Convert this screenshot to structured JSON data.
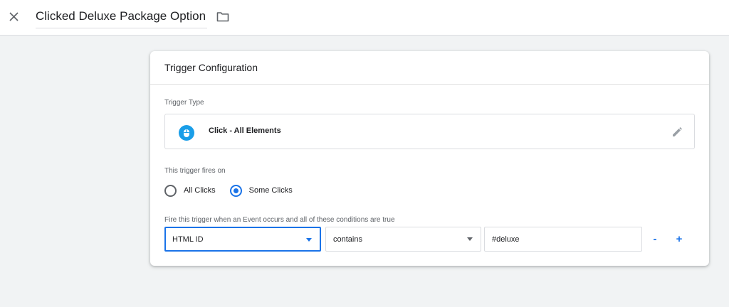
{
  "header": {
    "title": "Clicked Deluxe Package Option",
    "close_icon": "close-icon",
    "folder_icon": "folder-icon"
  },
  "card": {
    "title": "Trigger Configuration",
    "trigger_type": {
      "label": "Trigger Type",
      "icon": "mouse-icon",
      "name": "Click - All Elements",
      "edit_icon": "pencil-icon"
    },
    "fires_on": {
      "label": "This trigger fires on",
      "options": [
        {
          "label": "All Clicks",
          "selected": false
        },
        {
          "label": "Some Clicks",
          "selected": true
        }
      ]
    },
    "conditions": {
      "label": "Fire this trigger when an Event occurs and all of these conditions are true",
      "variable": "HTML ID",
      "operator": "contains",
      "value": "#deluxe",
      "remove_label": "-",
      "add_label": "+"
    }
  },
  "colors": {
    "accent": "#1a73e8",
    "icon_bg": "#1a9ee8",
    "page_bg": "#f1f3f4"
  }
}
